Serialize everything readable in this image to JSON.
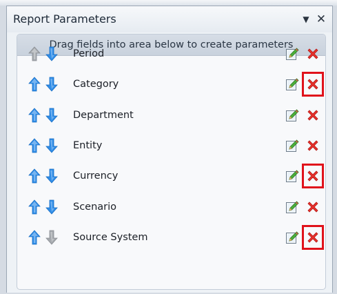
{
  "panel": {
    "title": "Report Parameters",
    "title_buttons": {
      "dropdown_icon": "triangle-down-icon",
      "close_icon": "close-icon",
      "dropdown_glyph": "▼",
      "close_glyph": "✕"
    }
  },
  "hint": "Drag fields into area below to create parameters",
  "parameters": [
    {
      "label": "Period",
      "move_up_enabled": false,
      "move_down_enabled": true,
      "delete_highlighted": false
    },
    {
      "label": "Category",
      "move_up_enabled": true,
      "move_down_enabled": true,
      "delete_highlighted": true
    },
    {
      "label": "Department",
      "move_up_enabled": true,
      "move_down_enabled": true,
      "delete_highlighted": false
    },
    {
      "label": "Entity",
      "move_up_enabled": true,
      "move_down_enabled": true,
      "delete_highlighted": false
    },
    {
      "label": "Currency",
      "move_up_enabled": true,
      "move_down_enabled": true,
      "delete_highlighted": true
    },
    {
      "label": "Scenario",
      "move_up_enabled": true,
      "move_down_enabled": true,
      "delete_highlighted": false
    },
    {
      "label": "Source System",
      "move_up_enabled": true,
      "move_down_enabled": false,
      "delete_highlighted": true
    }
  ],
  "colors": {
    "arrow_enabled": "#2f8de8",
    "arrow_disabled": "#a4a8ad",
    "delete_red": "#e8312c",
    "highlight_red": "#e0121b"
  }
}
